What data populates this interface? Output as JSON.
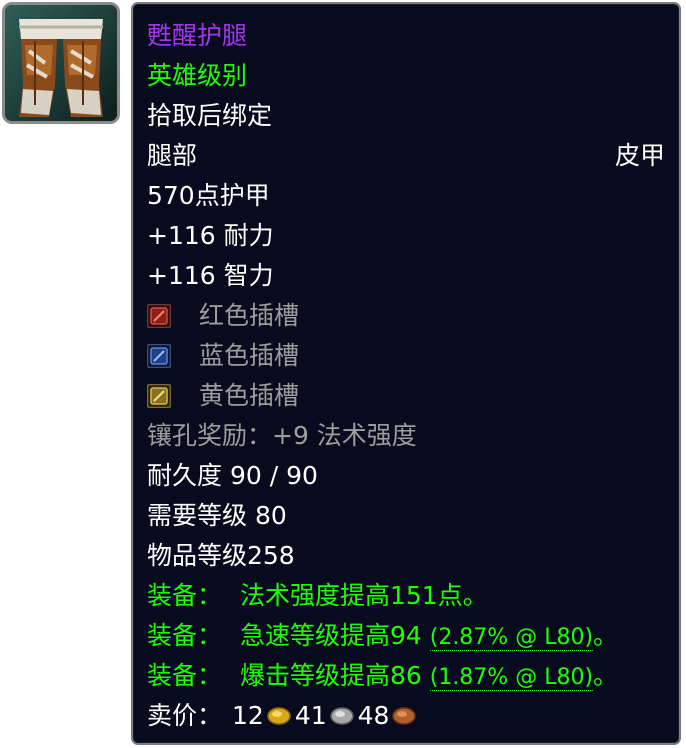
{
  "icon": {
    "name": "leggings-icon"
  },
  "item": {
    "name": "甦醒护腿",
    "quality": "英雄级别",
    "binding": "拾取后绑定",
    "slot": "腿部",
    "armor_type": "皮甲",
    "armor": "570点护甲",
    "stats": [
      "+116 耐力",
      "+116 智力"
    ],
    "sockets": [
      {
        "label": "红色插槽",
        "color": "#c0392b"
      },
      {
        "label": "蓝色插槽",
        "color": "#2c5fb3"
      },
      {
        "label": "黄色插槽",
        "color": "#c9a227"
      }
    ],
    "socket_bonus": "镶孔奖励：+9 法术强度",
    "durability": "耐久度 90 / 90",
    "required_level": "需要等级 80",
    "item_level": "物品等级258",
    "equip_effects": [
      {
        "prefix": "装备：",
        "text": "法术强度提高151点。",
        "rating": "",
        "suffix": ""
      },
      {
        "prefix": "装备：",
        "text": "急速等级提高94",
        "rating": "(2.87% @ L80)",
        "suffix": "。"
      },
      {
        "prefix": "装备：",
        "text": "爆击等级提高86",
        "rating": "(1.87% @ L80)",
        "suffix": "。"
      }
    ],
    "sell_price": {
      "label": "卖价：",
      "gold": "12",
      "silver": "41",
      "copper": "48"
    }
  },
  "colors": {
    "epic": "#a335ee",
    "uncommon": "#1eff00",
    "gray": "#9d9d9d",
    "background": "#080b1e"
  }
}
